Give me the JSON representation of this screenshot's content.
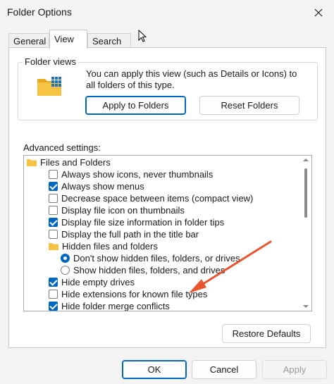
{
  "window": {
    "title": "Folder Options"
  },
  "tabs": [
    {
      "label": "General",
      "active": false
    },
    {
      "label": "View",
      "active": true
    },
    {
      "label": "Search",
      "active": false
    }
  ],
  "folder_views": {
    "legend": "Folder views",
    "description": "You can apply this view (such as Details or Icons) to all folders of this type.",
    "apply_label": "Apply to Folders",
    "reset_label": "Reset Folders"
  },
  "advanced": {
    "label": "Advanced settings:",
    "items": [
      {
        "type": "folder",
        "label": "Files and Folders"
      },
      {
        "type": "checkbox",
        "label": "Always show icons, never thumbnails",
        "checked": false
      },
      {
        "type": "checkbox",
        "label": "Always show menus",
        "checked": true
      },
      {
        "type": "checkbox",
        "label": "Decrease space between items (compact view)",
        "checked": false
      },
      {
        "type": "checkbox",
        "label": "Display file icon on thumbnails",
        "checked": false
      },
      {
        "type": "checkbox",
        "label": "Display file size information in folder tips",
        "checked": true
      },
      {
        "type": "checkbox",
        "label": "Display the full path in the title bar",
        "checked": false
      },
      {
        "type": "folder",
        "label": "Hidden files and folders"
      },
      {
        "type": "radio",
        "label": "Don't show hidden files, folders, or drives",
        "checked": true
      },
      {
        "type": "radio",
        "label": "Show hidden files, folders, and drives",
        "checked": false
      },
      {
        "type": "checkbox",
        "label": "Hide empty drives",
        "checked": true
      },
      {
        "type": "checkbox",
        "label": "Hide extensions for known file types",
        "checked": false
      },
      {
        "type": "checkbox",
        "label": "Hide folder merge conflicts",
        "checked": true
      }
    ],
    "restore_label": "Restore Defaults"
  },
  "footer": {
    "ok_label": "OK",
    "cancel_label": "Cancel",
    "apply_label": "Apply"
  },
  "colors": {
    "accent": "#0067c0",
    "annotation_arrow": "#e8552f",
    "folder": "#f6c343"
  },
  "icons": [
    "close-icon",
    "folder-grid-icon",
    "folder-icon",
    "arrow-annotation",
    "mouse-cursor-icon"
  ]
}
